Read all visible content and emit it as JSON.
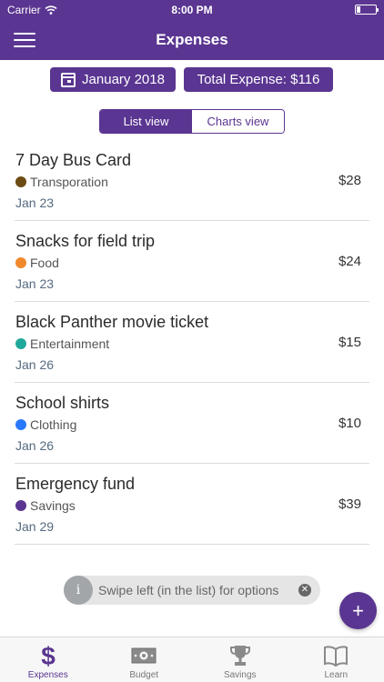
{
  "status_bar": {
    "carrier": "Carrier",
    "time": "8:00 PM"
  },
  "nav": {
    "title": "Expenses"
  },
  "summary": {
    "month": "January 2018",
    "total": "Total Expense: $116"
  },
  "segment": {
    "list": "List view",
    "charts": "Charts view",
    "active": "list"
  },
  "expenses": [
    {
      "name": "7 Day Bus Card",
      "category": "Transporation",
      "category_color": "#6b4c12",
      "date": "Jan 23",
      "amount": "$28"
    },
    {
      "name": "Snacks for field trip",
      "category": "Food",
      "category_color": "#f0892c",
      "date": "Jan 23",
      "amount": "$24"
    },
    {
      "name": "Black Panther movie ticket",
      "category": "Entertainment",
      "category_color": "#1fa99a",
      "date": "Jan 26",
      "amount": "$15"
    },
    {
      "name": "School shirts",
      "category": "Clothing",
      "category_color": "#2979ff",
      "date": "Jan 26",
      "amount": "$10"
    },
    {
      "name": "Emergency fund",
      "category": "Savings",
      "category_color": "#5a3591",
      "date": "Jan 29",
      "amount": "$39"
    }
  ],
  "toast": {
    "icon_letter": "i",
    "message": "Swipe left (in the list) for options"
  },
  "fab": {
    "label": "+"
  },
  "tabs": [
    {
      "label": "Expenses",
      "icon": "dollar-icon",
      "active": true
    },
    {
      "label": "Budget",
      "icon": "cash-icon",
      "active": false
    },
    {
      "label": "Savings",
      "icon": "trophy-icon",
      "active": false
    },
    {
      "label": "Learn",
      "icon": "book-icon",
      "active": false
    }
  ],
  "colors": {
    "primary": "#5a3591",
    "tab_inactive": "#777777"
  }
}
